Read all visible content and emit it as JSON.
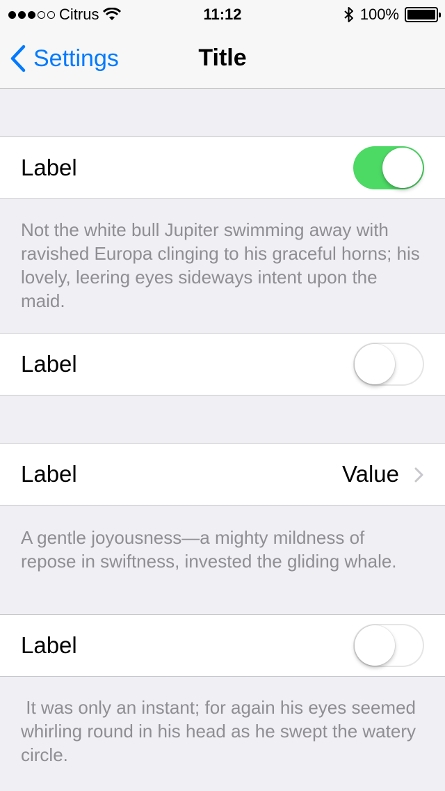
{
  "status_bar": {
    "carrier": "Citrus",
    "time": "11:12",
    "battery": "100%",
    "signal_bars_filled": 3,
    "signal_bars_total": 5
  },
  "nav": {
    "back_label": "Settings",
    "title": "Title",
    "accent_color": "#007aff"
  },
  "rows": [
    {
      "label": "Label",
      "toggle_on": true
    },
    {
      "label": "Label",
      "toggle_on": false
    },
    {
      "label": "Label",
      "value": "Value"
    },
    {
      "label": "Label",
      "toggle_on": false
    }
  ],
  "footers": [
    "Not the white bull Jupiter swimming away with ravished Europa clinging to his graceful horns; his lovely, leering eyes sideways intent upon the maid.",
    "A gentle joyousness—a mighty mildness of repose in swiftness, invested the gliding whale.",
    " It was only an instant; for again his eyes seemed whirling round in his head as he swept the watery circle."
  ],
  "colors": {
    "switch_on": "#4cd964",
    "background": "#efeff4",
    "footer_text": "#8e8e93"
  }
}
